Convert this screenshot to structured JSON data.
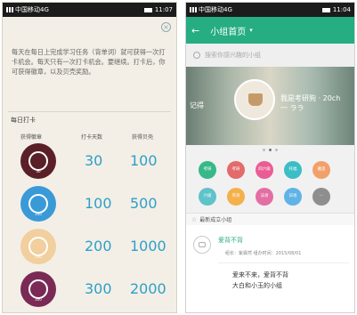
{
  "left": {
    "status": {
      "carrier": "中国移动4G",
      "time": "11:07"
    },
    "close_icon": "×",
    "notice": "每天在每日上完成学习任务（背单词）就可获得一次打卡机会。每天只有一次打卡机会。要继续。打卡后，你可获得徽章，以及贝壳奖励。",
    "section_title": "每日打卡",
    "columns": [
      "获得徽章",
      "打卡天数",
      "获得贝壳"
    ],
    "rows": [
      {
        "badge_color": "#5a1f27",
        "badge_text": "30",
        "days": "30",
        "points": "100"
      },
      {
        "badge_color": "#3a9ad8",
        "badge_text": "100",
        "days": "100",
        "points": "500"
      },
      {
        "badge_color": "#f1cf9e",
        "badge_text": "200",
        "days": "200",
        "points": "1000"
      },
      {
        "badge_color": "#7a2a55",
        "badge_text": "300",
        "days": "300",
        "points": "2000"
      }
    ]
  },
  "right": {
    "status": {
      "carrier": "中国移动4G",
      "time": "11:04"
    },
    "appbar": {
      "back_icon": "←",
      "title": "小组首页",
      "dropdown_icon": "▾"
    },
    "search": {
      "placeholder": "搜索你感兴趣的小组"
    },
    "banner": {
      "left_text": "记得",
      "right_text": "我是考研狗 · 20ch\n一 ララ"
    },
    "carousel_dots": 3,
    "categories": [
      {
        "label": "考研",
        "color": "#37b88a"
      },
      {
        "label": "考研",
        "color": "#e46b6b"
      },
      {
        "label": "四六级",
        "color": "#e95d94"
      },
      {
        "label": "托福",
        "color": "#3bbdc6"
      },
      {
        "label": "雅思",
        "color": "#f2a06a"
      },
      {
        "label": "六级",
        "color": "#5fc3c9"
      },
      {
        "label": "英语",
        "color": "#f4b04a"
      },
      {
        "label": "法语",
        "color": "#e36ea3"
      },
      {
        "label": "日语",
        "color": "#5fb3e6"
      },
      {
        "label": "···",
        "color": "#8e8e8e"
      }
    ],
    "section_title": "最新成立小组",
    "group": {
      "name": "爱背不背",
      "meta": "组长：紫霖然    组办时间：2015/08/01",
      "slogan": "爱来不来，爱背不背\n大白和小玉的小组"
    }
  }
}
